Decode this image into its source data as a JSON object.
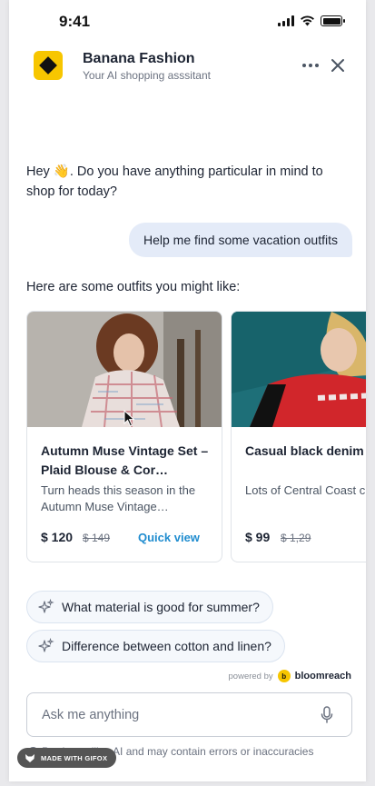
{
  "status_bar": {
    "time": "9:41"
  },
  "header": {
    "title": "Banana Fashion",
    "subtitle": "Your AI shopping asssitant"
  },
  "messages": {
    "bot_greeting": "Hey 👋. Do you have anything particular in mind to shop for today?",
    "user_request": "Help me find some vacation outfits",
    "bot_intro": "Here are some outfits you might like:"
  },
  "products": [
    {
      "title": "Autumn Muse Vintage Set – Plaid Blouse & Cor…",
      "description": "Turn heads this season in the Autumn Muse Vintage…",
      "price": "$ 120",
      "old_price": "$ 149",
      "action": "Quick view"
    },
    {
      "title": "Casual black denim jacket",
      "description": "Lots of Central Coast character with a medi",
      "price": "$ 99",
      "old_price": "$ 1,29"
    }
  ],
  "suggestions": [
    "What material is good for summer?",
    "Difference between cotton and linen?"
  ],
  "powered_by": {
    "label": "powered by",
    "brand": "bloomreach"
  },
  "input": {
    "placeholder": "Ask me anything"
  },
  "disclaimer": "Product utilise AI and may contain errors or inaccuracies",
  "watermark": "MADE WITH GIFOX",
  "colors": {
    "accent": "#1f8ccf",
    "user_bubble": "#e4ebf8",
    "logo_yellow": "#f7c600"
  }
}
